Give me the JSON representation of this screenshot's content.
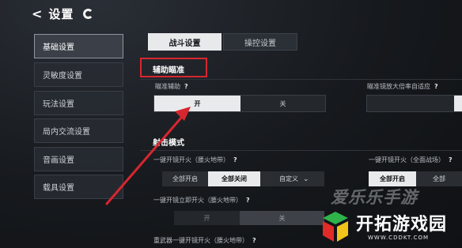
{
  "header": {
    "back_glyph": "<",
    "title": "设置",
    "icon": "settings-ring-icon"
  },
  "sidebar": {
    "items": [
      {
        "label": "基础设置"
      },
      {
        "label": "灵敏度设置"
      },
      {
        "label": "玩法设置"
      },
      {
        "label": "局内交流设置"
      },
      {
        "label": "音画设置"
      },
      {
        "label": "载具设置"
      }
    ]
  },
  "tabs": [
    {
      "label": "战斗设置"
    },
    {
      "label": "操控设置"
    }
  ],
  "aim_assist": {
    "section_title": "辅助瞄准",
    "assist_label": "瞄准辅助",
    "assist_options": [
      "开",
      "关"
    ],
    "scope_label": "瞄准镜放大倍率自适应"
  },
  "fire_mode": {
    "section_title": "射击模式",
    "one_key_hip_label": "一键开镜开火（腰火地带）",
    "one_key_hip_options": [
      "全部开启",
      "全部关闭",
      "自定义"
    ],
    "one_key_all_label": "一键开镜开火（全面战场）",
    "one_key_all_options": [
      "全部开启",
      "全部"
    ],
    "instant_fire_label": "一键开镜立即开火（腰火地带）",
    "instant_fire_options": [
      "开",
      "关"
    ],
    "heavy_weapon_label": "重武器一键开镜开火（腰火地带）",
    "help_glyph": "?"
  },
  "watermark": {
    "top_text": "爱乐乐手游",
    "main_text": "开拓游戏园",
    "url": "WWW.CDDKT.COM"
  },
  "colors": {
    "annotation_red": "#d8262f",
    "selected_fill": "#e8eaec",
    "watermark_green": "#2fb34a"
  }
}
